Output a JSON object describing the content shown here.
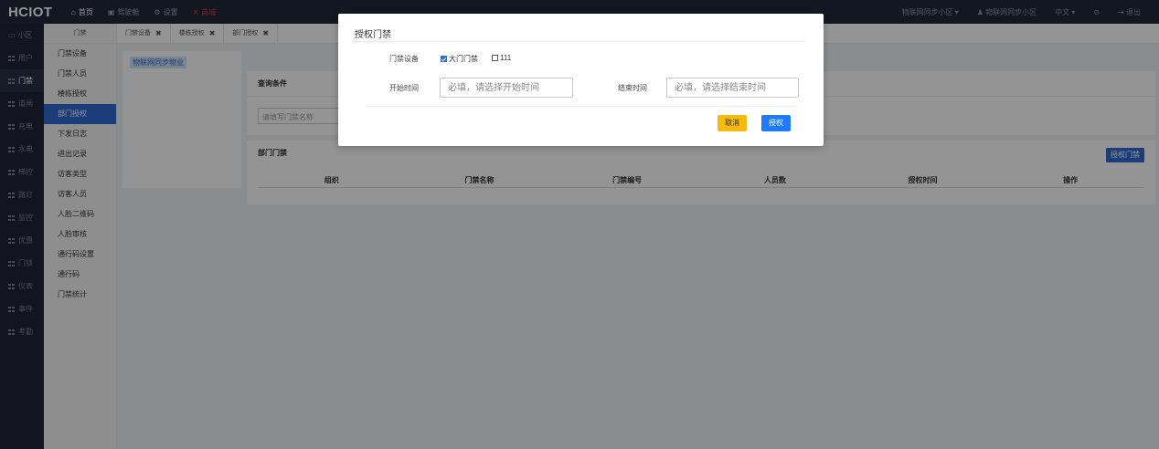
{
  "brand": "HCIOT",
  "topnav": [
    {
      "label": "首页",
      "icon": "home-icon",
      "glyph": "⌂"
    },
    {
      "label": "驾驶舱",
      "icon": "dashboard-icon",
      "glyph": "▣"
    },
    {
      "label": "设置",
      "icon": "gear-icon",
      "glyph": "⚙"
    },
    {
      "label": "商城",
      "icon": "cart-icon",
      "glyph": "✕"
    }
  ],
  "topright": [
    "物联网同步小区 ▾",
    "♟ 物联网同步小区",
    "中文 ▾",
    "⊘",
    "⇥ 退出"
  ],
  "sidebar": [
    "小区",
    "用户",
    "门禁",
    "道闸",
    "充电",
    "水电",
    "梯控",
    "路灯",
    "监控",
    "优惠",
    "门锁",
    "仪表",
    "事件",
    "考勤"
  ],
  "submenu": {
    "head": "门禁",
    "items": [
      "门禁设备",
      "门禁人员",
      "楼栋授权",
      "部门授权",
      "下发日志",
      "进出记录",
      "访客类型",
      "访客人员",
      "人脸二维码",
      "人脸审核",
      "通行码设置",
      "通行码",
      "门禁统计"
    ]
  },
  "tabs": [
    {
      "label": "门禁设备",
      "close": "✖"
    },
    {
      "label": "楼栋授权",
      "close": "✖"
    },
    {
      "label": "部门授权",
      "close": "✖"
    }
  ],
  "tree": {
    "node": "物联网同步物业"
  },
  "query": {
    "title": "查询条件",
    "placeholder": "请填写门禁名称"
  },
  "deptPanel": {
    "title": "部门门禁",
    "authButton": "授权门禁",
    "columns": [
      "组织",
      "门禁名称",
      "门禁编号",
      "人员数",
      "授权时间",
      "操作"
    ]
  },
  "modal": {
    "title": "授权门禁",
    "deviceLabel": "门禁设备",
    "devices": [
      {
        "label": "大门门禁",
        "checked": true
      },
      {
        "label": "111",
        "checked": false
      }
    ],
    "startLabel": "开始时间",
    "startPlaceholder": "必填，请选择开始时间",
    "endLabel": "结束时间",
    "endPlaceholder": "必填，请选择结束时间",
    "cancel": "取消",
    "ok": "授权"
  },
  "colors": {
    "primary": "#1e7bff",
    "cancel": "#f7ba0b",
    "topbar": "#22283a"
  }
}
